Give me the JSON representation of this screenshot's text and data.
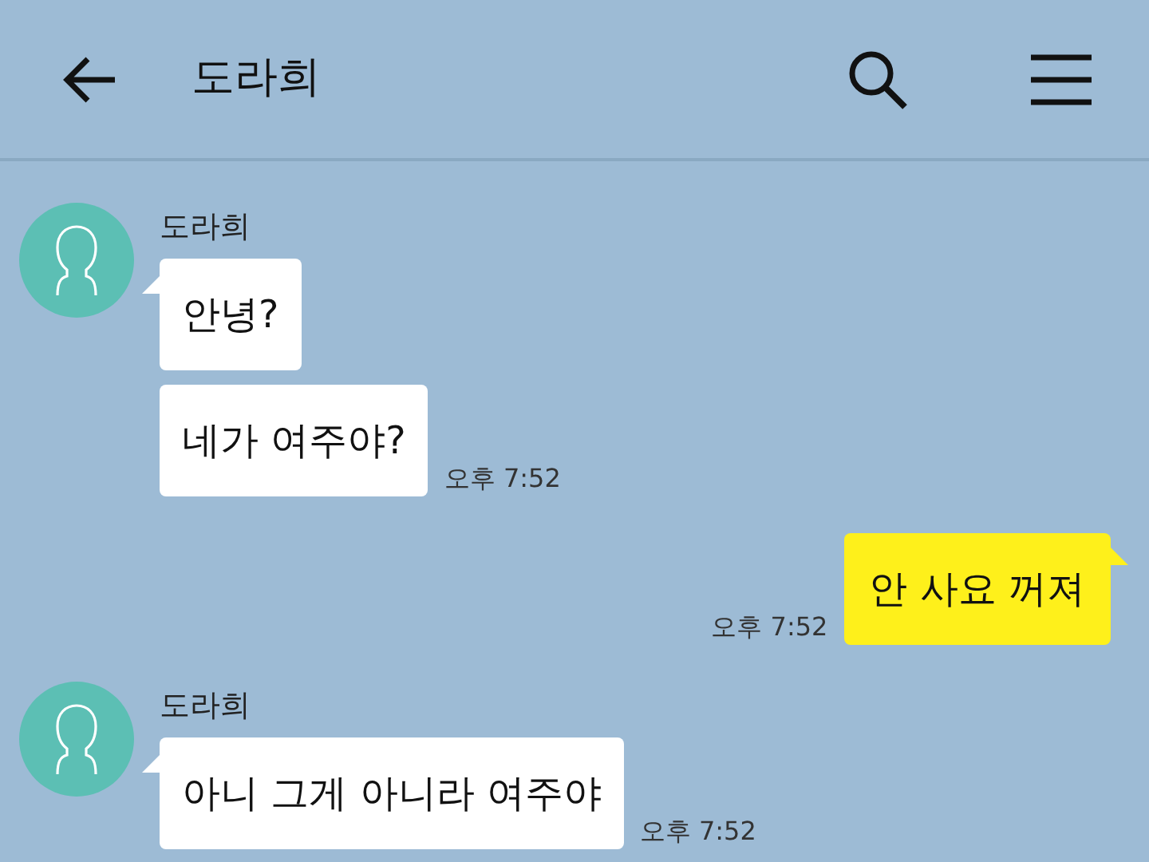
{
  "header": {
    "title": "도라희"
  },
  "messages": [
    {
      "kind": "received",
      "sender": "도라희",
      "bubbles": [
        {
          "text": "안녕?"
        },
        {
          "text": "네가 여주야?"
        }
      ],
      "time": "오후 7:52"
    },
    {
      "kind": "sent",
      "bubbles": [
        {
          "text": "안 사요 꺼져"
        }
      ],
      "time": "오후 7:52"
    },
    {
      "kind": "received",
      "sender": "도라희",
      "bubbles": [
        {
          "text": "아니 그게 아니라 여주야"
        }
      ],
      "time": "오후 7:52"
    }
  ]
}
